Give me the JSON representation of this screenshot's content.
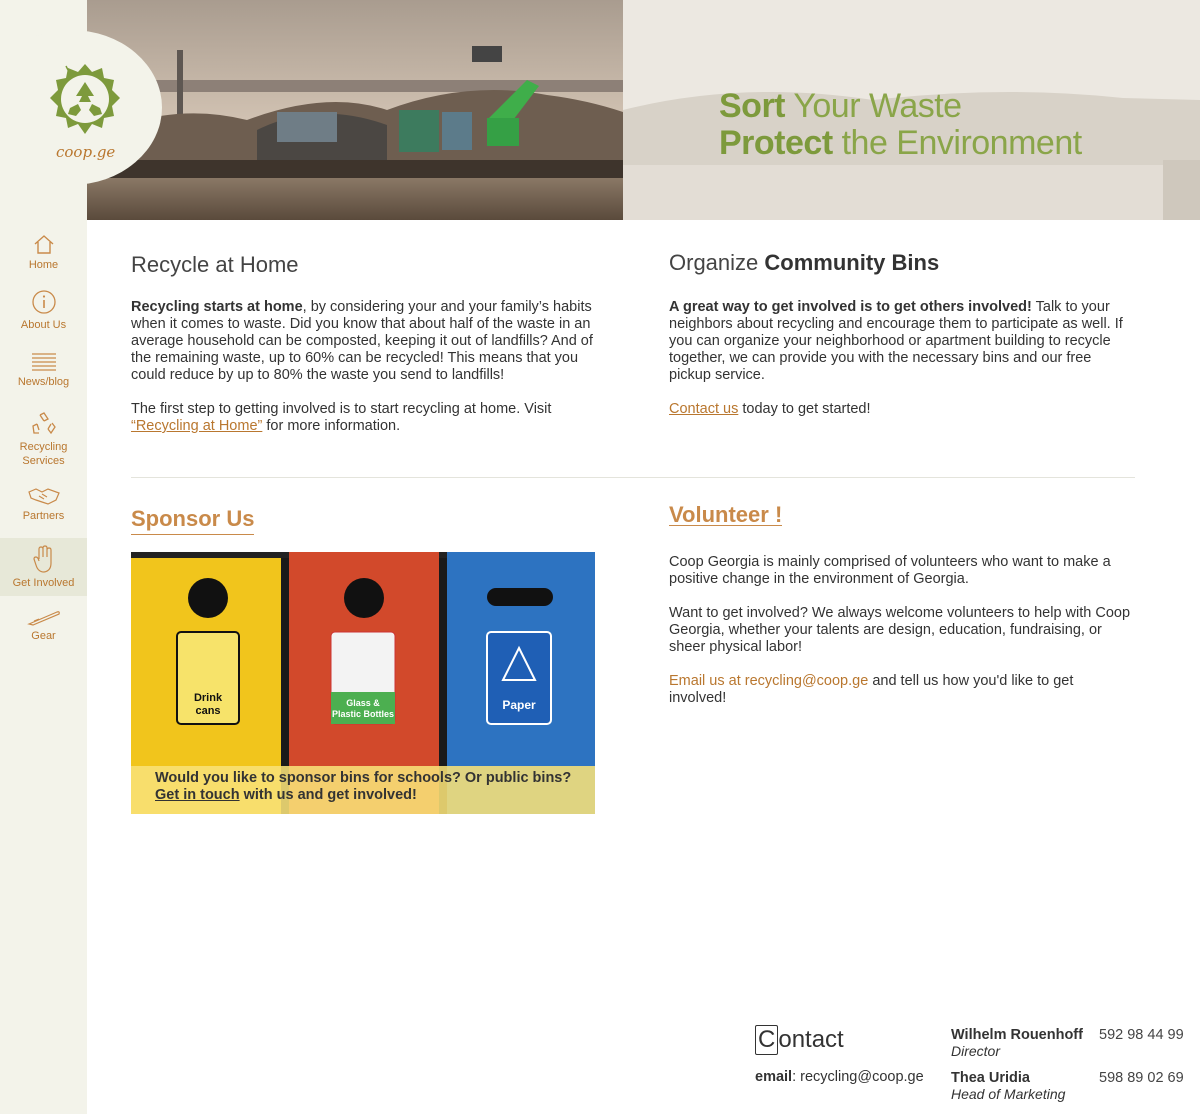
{
  "brand": {
    "logo_text": "coop.ge",
    "accent": "#b9772f",
    "green": "#7d9a3c"
  },
  "nav": [
    {
      "label": "Home",
      "icon": "home-icon"
    },
    {
      "label": "About Us",
      "icon": "info-icon"
    },
    {
      "label": "News/blog",
      "icon": "news-icon"
    },
    {
      "label": "Recycling Services",
      "icon": "recycle-icon"
    },
    {
      "label": "Partners",
      "icon": "handshake-icon"
    },
    {
      "label": "Get Involved",
      "icon": "hand-icon",
      "active": true
    },
    {
      "label": "Gear",
      "icon": "gear-icon"
    }
  ],
  "hero": {
    "line1_bold": "Sort",
    "line1_rest": "Your Waste",
    "line2_bold": "Protect",
    "line2_rest": "the Environment"
  },
  "recycle_home": {
    "title": "Recycle at Home",
    "p1_bold": "Recycling starts at home",
    "p1_rest": ", by considering your and your family’s habits when it comes to waste.  Did you know that about half of the waste in an average household can be composted, keeping it out of landfills?  And of the remaining waste, up to 60% can be recycled!  This means that you could reduce by up to 80% the waste you send to landfills!",
    "p2_pre": "The first step to getting involved is to start recycling at home.  Visit",
    "p2_link": "“Recycling at Home”",
    "p2_post": "for more information."
  },
  "community": {
    "title_light": "Organize",
    "title_bold": "Community Bins",
    "p1_bold": "A great way to get involved is to get others involved!",
    "p1_rest": "Talk to your neighbors about recycling and encourage them to participate as well.  If you can organize your neighborhood or apartment building to recycle together, we can provide you with the necessary bins and our free pickup service.",
    "p2_link": "Contact us",
    "p2_rest": "today to get started!"
  },
  "sponsor": {
    "title": "Sponsor Us",
    "bins": [
      "Drink cans",
      "Glass & Plastic Bottles",
      "Paper"
    ],
    "caption_line1": "Would you like to sponsor bins for schools? Or public bins?",
    "caption_link": "Get in touch",
    "caption_rest": "with us and get involved!"
  },
  "volunteer": {
    "title": "Volunteer !",
    "p1": "Coop Georgia is mainly comprised of volunteers who want to make a positive change in the environment of Georgia.",
    "p2": "Want to get involved?  We always welcome volunteers to help with Coop Georgia, whether your talents are design, education, fundraising, or sheer physical labor!",
    "p3_link": "Email us at recycling@coop.ge",
    "p3_rest": "and tell us how you'd like to get involved!"
  },
  "contact": {
    "title_first": "C",
    "title_rest": "ontact",
    "email_label": "email",
    "email_value": ": recycling@coop.ge",
    "people": [
      {
        "name": "Wilhelm Rouenhoff",
        "role": "Director",
        "phone": "592 98 44 99"
      },
      {
        "name": "Thea Uridia",
        "role": "Head of Marketing",
        "phone": "598 89 02 69"
      }
    ]
  }
}
